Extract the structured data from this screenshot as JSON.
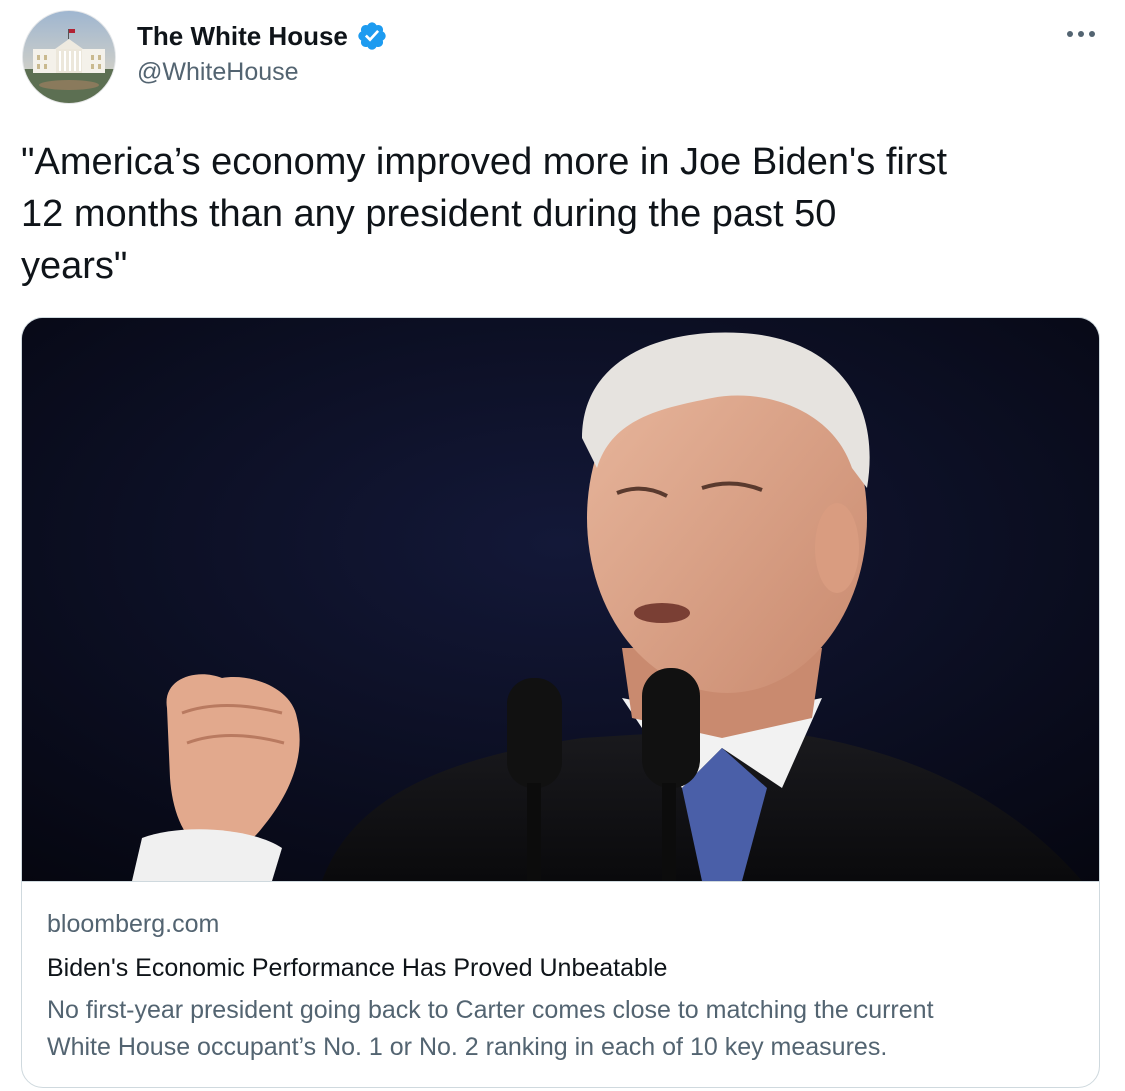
{
  "author": {
    "display_name": "The White House",
    "handle": "@WhiteHouse",
    "verified": true,
    "avatar_icon": "white-house-avatar",
    "verified_color": "#1d9bf0"
  },
  "menu": {
    "icon": "more-options-icon"
  },
  "tweet": {
    "text": "\"America’s economy improved more in Joe Biden's first\n12 months than any president during the past 50\nyears\""
  },
  "link_card": {
    "image_icon": "article-photo",
    "domain": "bloomberg.com",
    "title": "Biden's Economic Performance Has Proved Unbeatable",
    "description": "No first-year president going back to Carter comes close to matching the current\nWhite House occupant’s No. 1 or No. 2 ranking in each of 10 key measures."
  }
}
